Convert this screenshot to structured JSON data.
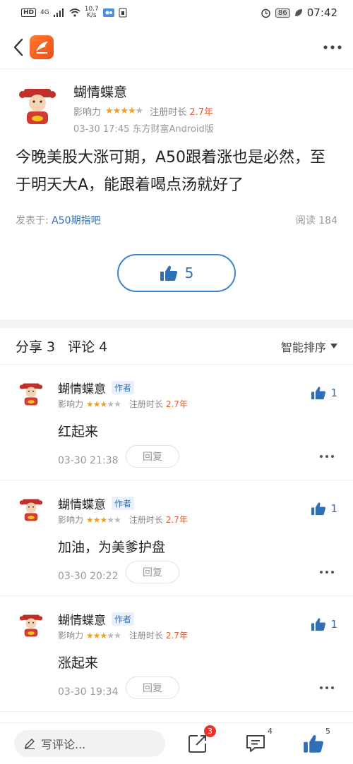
{
  "status_bar": {
    "network": "HD",
    "signal": "4G",
    "speed_value": "10.7",
    "speed_unit": "K/s",
    "battery": "86",
    "time": "07:42"
  },
  "post": {
    "author": "蝴情蝶意",
    "influence_label": "影响力",
    "influence_stars": 4,
    "reg_label": "注册时长",
    "reg_value": "2.7年",
    "time_source": "03-30 17:45 东方财富Android版",
    "body": "今晚美股大涨可期，A50跟着涨也是必然，至于明天大A，能跟着喝点汤就好了",
    "posted_in_label": "发表于:",
    "forum": "A50期指吧",
    "read_label": "阅读 184",
    "likes": "5"
  },
  "comments_header": {
    "share_label": "分享 3",
    "comment_label": "评论 4",
    "sort_label": "智能排序"
  },
  "comments": [
    {
      "author": "蝴情蝶意",
      "tag": "作者",
      "influence_label": "影响力",
      "stars": 3,
      "reg_label": "注册时长",
      "reg_value": "2.7年",
      "likes": "1",
      "text": "红起来",
      "time": "03-30 21:38",
      "reply_label": "回复"
    },
    {
      "author": "蝴情蝶意",
      "tag": "作者",
      "influence_label": "影响力",
      "stars": 3,
      "reg_label": "注册时长",
      "reg_value": "2.7年",
      "likes": "1",
      "text": "加油，为美爹护盘",
      "time": "03-30 20:22",
      "reply_label": "回复"
    },
    {
      "author": "蝴情蝶意",
      "tag": "作者",
      "influence_label": "影响力",
      "stars": 3,
      "reg_label": "注册时长",
      "reg_value": "2.7年",
      "likes": "1",
      "text": "涨起来",
      "time": "03-30 19:34",
      "reply_label": "回复"
    }
  ],
  "bottom_bar": {
    "input_placeholder": "写评论...",
    "share_badge": "3",
    "comment_count": "4",
    "like_count": "5"
  },
  "colors": {
    "accent_blue": "#2f6fb5",
    "star_gold": "#f0a020",
    "highlight_orange": "#e25d2f",
    "badge_red": "#e8322b"
  }
}
